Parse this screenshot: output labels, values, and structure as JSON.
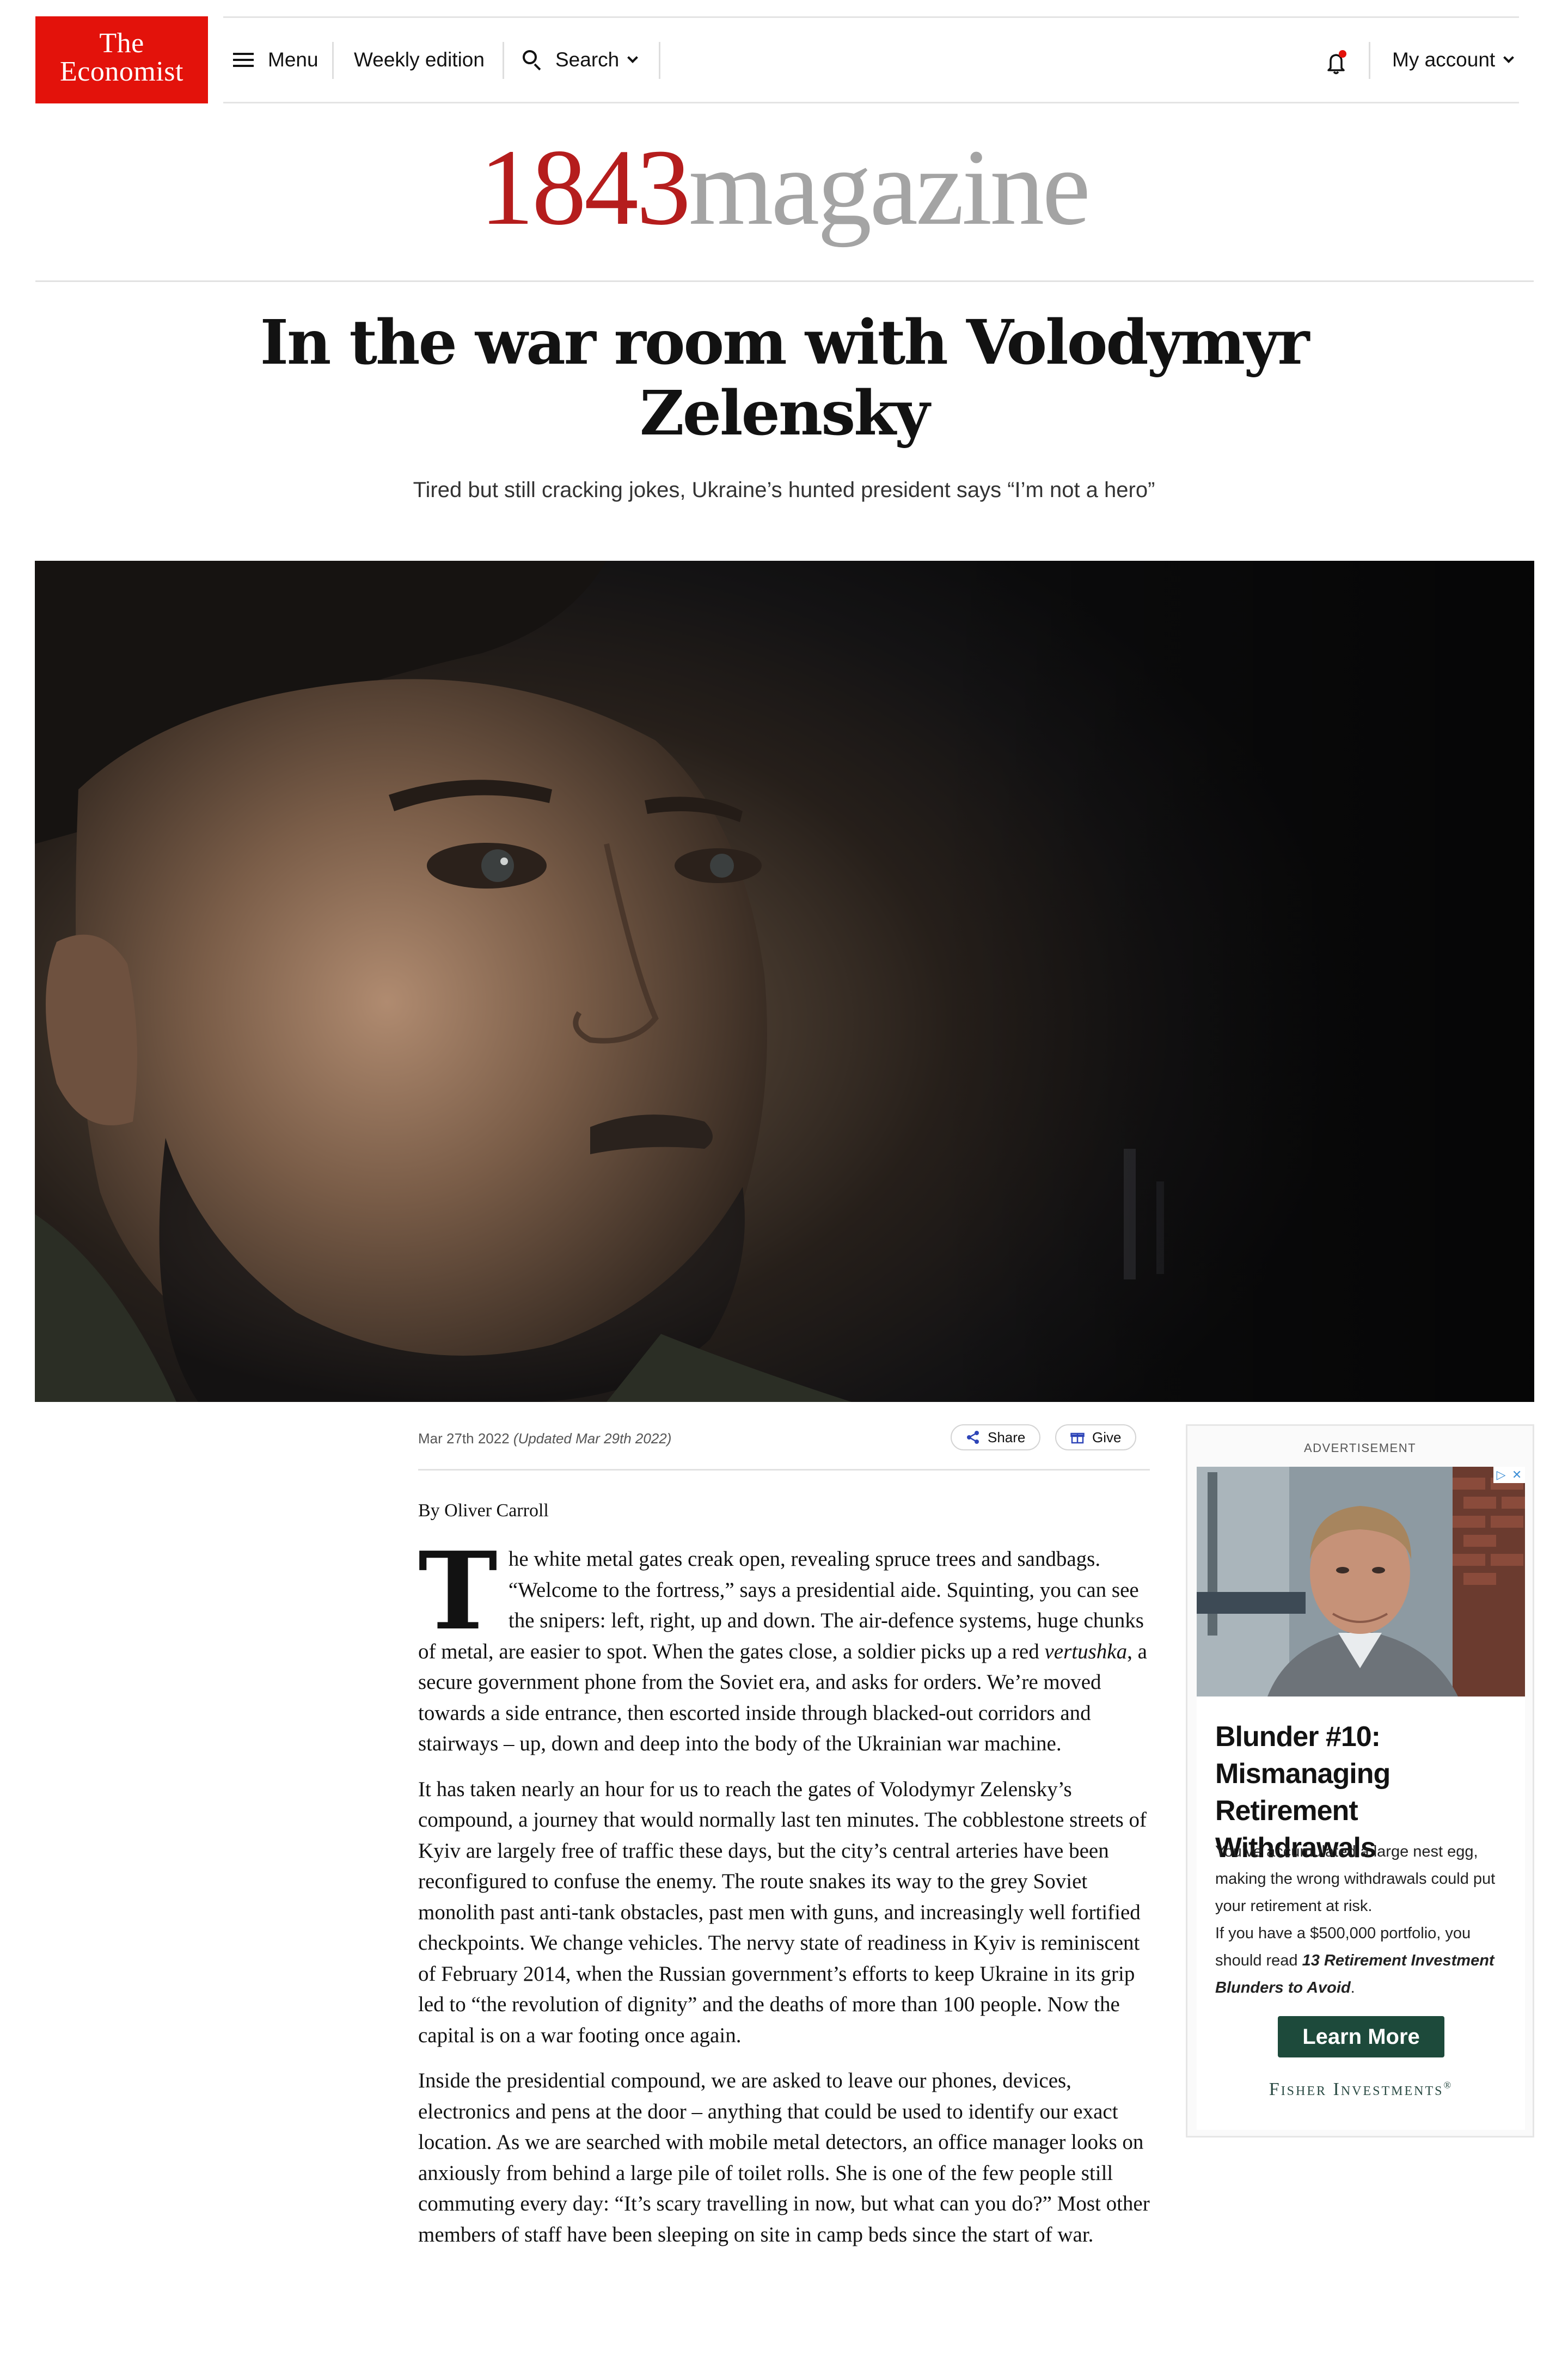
{
  "header": {
    "logo_line1": "The",
    "logo_line2": "Economist",
    "menu_label": "Menu",
    "weekly_edition_label": "Weekly edition",
    "search_label": "Search",
    "account_label": "My account",
    "brand_red": "#e3120b",
    "notification_icon": "bell-icon"
  },
  "masthead": {
    "number": "1843",
    "word": "magazine"
  },
  "article": {
    "headline_line1": "In the war room with Volodymyr",
    "headline_line2": "Zelensky",
    "standfirst": "Tired but still cracking jokes, Ukraine’s hunted president says “I’m not a hero”",
    "date": "Mar 27th 2022",
    "updated": "(Updated Mar 29th 2022)",
    "share_label": "Share",
    "give_label": "Give",
    "byline": "By Oliver Carroll",
    "dropcap": "T",
    "p1_a": "he white metal gates creak open, revealing spruce trees and sandbags. “Welcome to the fortress,” says a presidential aide. Squinting, you can see the snipers: left, right, up and down. The air-defence systems, huge chunks of metal, are easier to spot. When the gates close, a soldier picks up a red ",
    "p1_em": "vertushka",
    "p1_b": ", a secure government phone from the Soviet era, and asks for orders. We’re moved towards a side entrance, then escorted inside through blacked-out corridors and stairways – up, down and deep into the body of the Ukrainian war machine.",
    "p2": "It has taken nearly an hour for us to reach the gates of Volodymyr Zelensky’s compound, a journey that would normally last ten minutes. The cobblestone streets of Kyiv are largely free of traffic these days, but the city’s central arteries have been reconfigured to confuse the enemy. The route snakes its way to the grey Soviet monolith past anti-tank obstacles, past men with guns, and increasingly well fortified checkpoints. We change vehicles. The nervy state of readiness in Kyiv is reminiscent of February 2014, when the Russian government’s efforts to keep Ukraine in its grip led to “the revolution of dignity” and the deaths of more than 100 people. Now the capital is on a war footing once again.",
    "p3": "Inside the presidential compound, we are asked to leave our phones, devices, electronics and pens at the door – anything that could be used to identify our exact location. As we are searched with mobile metal detectors, an office manager looks on anxiously from behind a large pile of toilet rolls. She is one of the few people still commuting every day: “It’s scary travelling in now, but what can you do?” Most other members of staff have been sleeping on site in camp beds since the start of war."
  },
  "ad": {
    "label": "ADVERTISEMENT",
    "title_line1": "Blunder #10:",
    "title_line2": "Mismanaging Retirement",
    "title_line3": "Withdrawals",
    "text1": "You’ve accumulated a large nest egg, making the wrong withdrawals could put your retirement at risk.",
    "text2_a": "If you have a $500,000 portfolio, you should read ",
    "text2_b": "13 Retirement Investment Blunders to Avoid",
    "text2_c": ".",
    "button_label": "Learn More",
    "brand": "Fisher Investments",
    "brand_mark": "®",
    "button_color": "#1d4a3b"
  }
}
